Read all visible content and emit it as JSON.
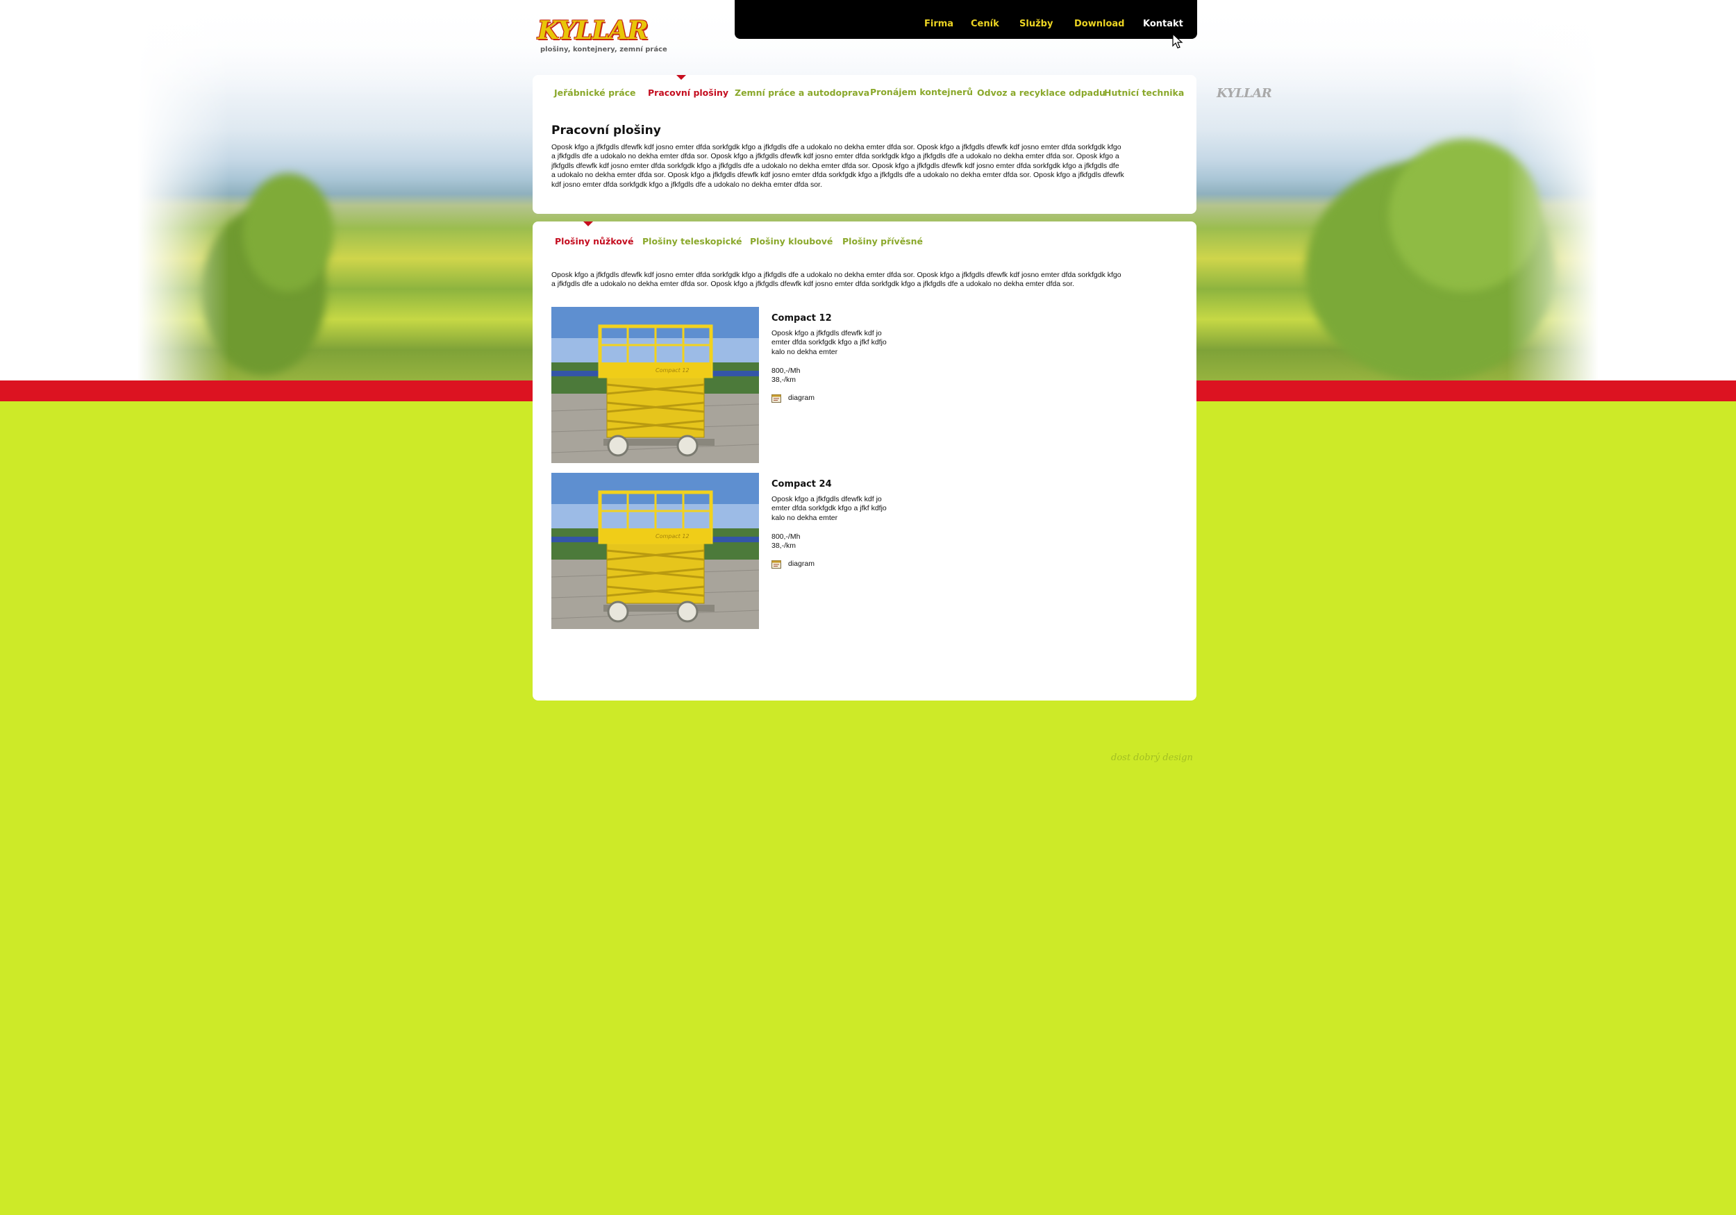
{
  "brand": {
    "name": "KYLLAR",
    "tagline": "plošiny, kontejnery, zemní práce",
    "side_logo": "KYLLAR"
  },
  "top_nav": [
    {
      "label": "Firma",
      "active": false
    },
    {
      "label": "Ceník",
      "active": false
    },
    {
      "label": "Služby",
      "active": false
    },
    {
      "label": "Download",
      "active": false
    },
    {
      "label": "Kontakt",
      "active": true
    }
  ],
  "services_nav": [
    {
      "label": "Jeřábnické práce",
      "active": false
    },
    {
      "label": "Pracovní plošiny",
      "active": true
    },
    {
      "label": "Zemní práce a autodoprava",
      "active": false
    },
    {
      "label": "Pronájem kontejnerů",
      "active": false
    },
    {
      "label": "Odvoz a recyklace odpadu",
      "active": false
    },
    {
      "label": "Hutnicí technika",
      "active": false
    }
  ],
  "intro": {
    "title": "Pracovní plošiny",
    "lines": [
      "Oposk kfgo a jfkfgdls dfewfk kdf josno  emter dfda sorkfgdk kfgo a jfkfgdls dfe a udokalo no dekha emter dfda sor. Oposk kfgo a jfkfgdls dfewfk kdf josno  emter dfda sorkfgdk kfgo",
      "a jfkfgdls dfe a udokalo no dekha emter dfda sor. Oposk kfgo a jfkfgdls dfewfk kdf josno  emter dfda sorkfgdk kfgo a jfkfgdls dfe a udokalo no dekha emter dfda sor. Oposk kfgo a",
      "jfkfgdls dfewfk kdf josno  emter dfda sorkfgdk kfgo a jfkfgdls dfe a udokalo no dekha emter dfda sor. Oposk kfgo a jfkfgdls dfewfk kdf josno  emter dfda sorkfgdk kfgo a jfkfgdls dfe",
      "a udokalo no dekha emter dfda sor. Oposk kfgo a jfkfgdls dfewfk kdf josno  emter dfda sorkfgdk kfgo a jfkfgdls dfe a udokalo no dekha emter dfda sor. Oposk kfgo a jfkfgdls dfewfk",
      "kdf josno  emter dfda sorkfgdk kfgo a jfkfgdls dfe a udokalo no dekha emter dfda sor."
    ]
  },
  "category_tabs": [
    {
      "label": "Plošiny nůžkové",
      "active": true
    },
    {
      "label": "Plošiny teleskopické",
      "active": false
    },
    {
      "label": "Plošiny kloubové",
      "active": false
    },
    {
      "label": "Plošiny přívěsné",
      "active": false
    }
  ],
  "category_text": [
    "Oposk kfgo a jfkfgdls dfewfk kdf josno  emter dfda sorkfgdk kfgo a jfkfgdls dfe a udokalo no dekha emter dfda sor. Oposk kfgo a jfkfgdls dfewfk kdf josno  emter dfda sorkfgdk kfgo",
    "a jfkfgdls dfe a udokalo no dekha emter dfda sor. Oposk kfgo a jfkfgdls dfewfk kdf josno  emter dfda sorkfgdk kfgo a jfkfgdls dfe a udokalo no dekha emter dfda sor."
  ],
  "products": [
    {
      "name": "Compact 12",
      "desc_lines": [
        "Oposk kfgo a jfkfgdls dfewfk kdf jo",
        "emter dfda sorkfgdk kfgo a jfkf kdfjo",
        "kalo no dekha emter"
      ],
      "price_hour": "800,-/Mh",
      "price_km": "38,-/km",
      "diagram_label": "diagram",
      "photo_label": "Compact 12"
    },
    {
      "name": "Compact 24",
      "desc_lines": [
        "Oposk kfgo a jfkfgdls dfewfk kdf jo",
        "emter dfda sorkfgdk kfgo a jfkf kdfjo",
        "kalo no dekha emter"
      ],
      "price_hour": "800,-/Mh",
      "price_km": "38,-/km",
      "diagram_label": "diagram",
      "photo_label": "Compact 12"
    }
  ],
  "footer": {
    "credit": "dost dobrý design"
  },
  "colors": {
    "background": "#cdea28",
    "stripe": "#dc1321",
    "nav_text": "#8aa82b",
    "nav_active": "#c40d1f",
    "top_nav_text": "#ecd423",
    "logo_fill": "#e8c608",
    "logo_outline": "#c52a14"
  }
}
